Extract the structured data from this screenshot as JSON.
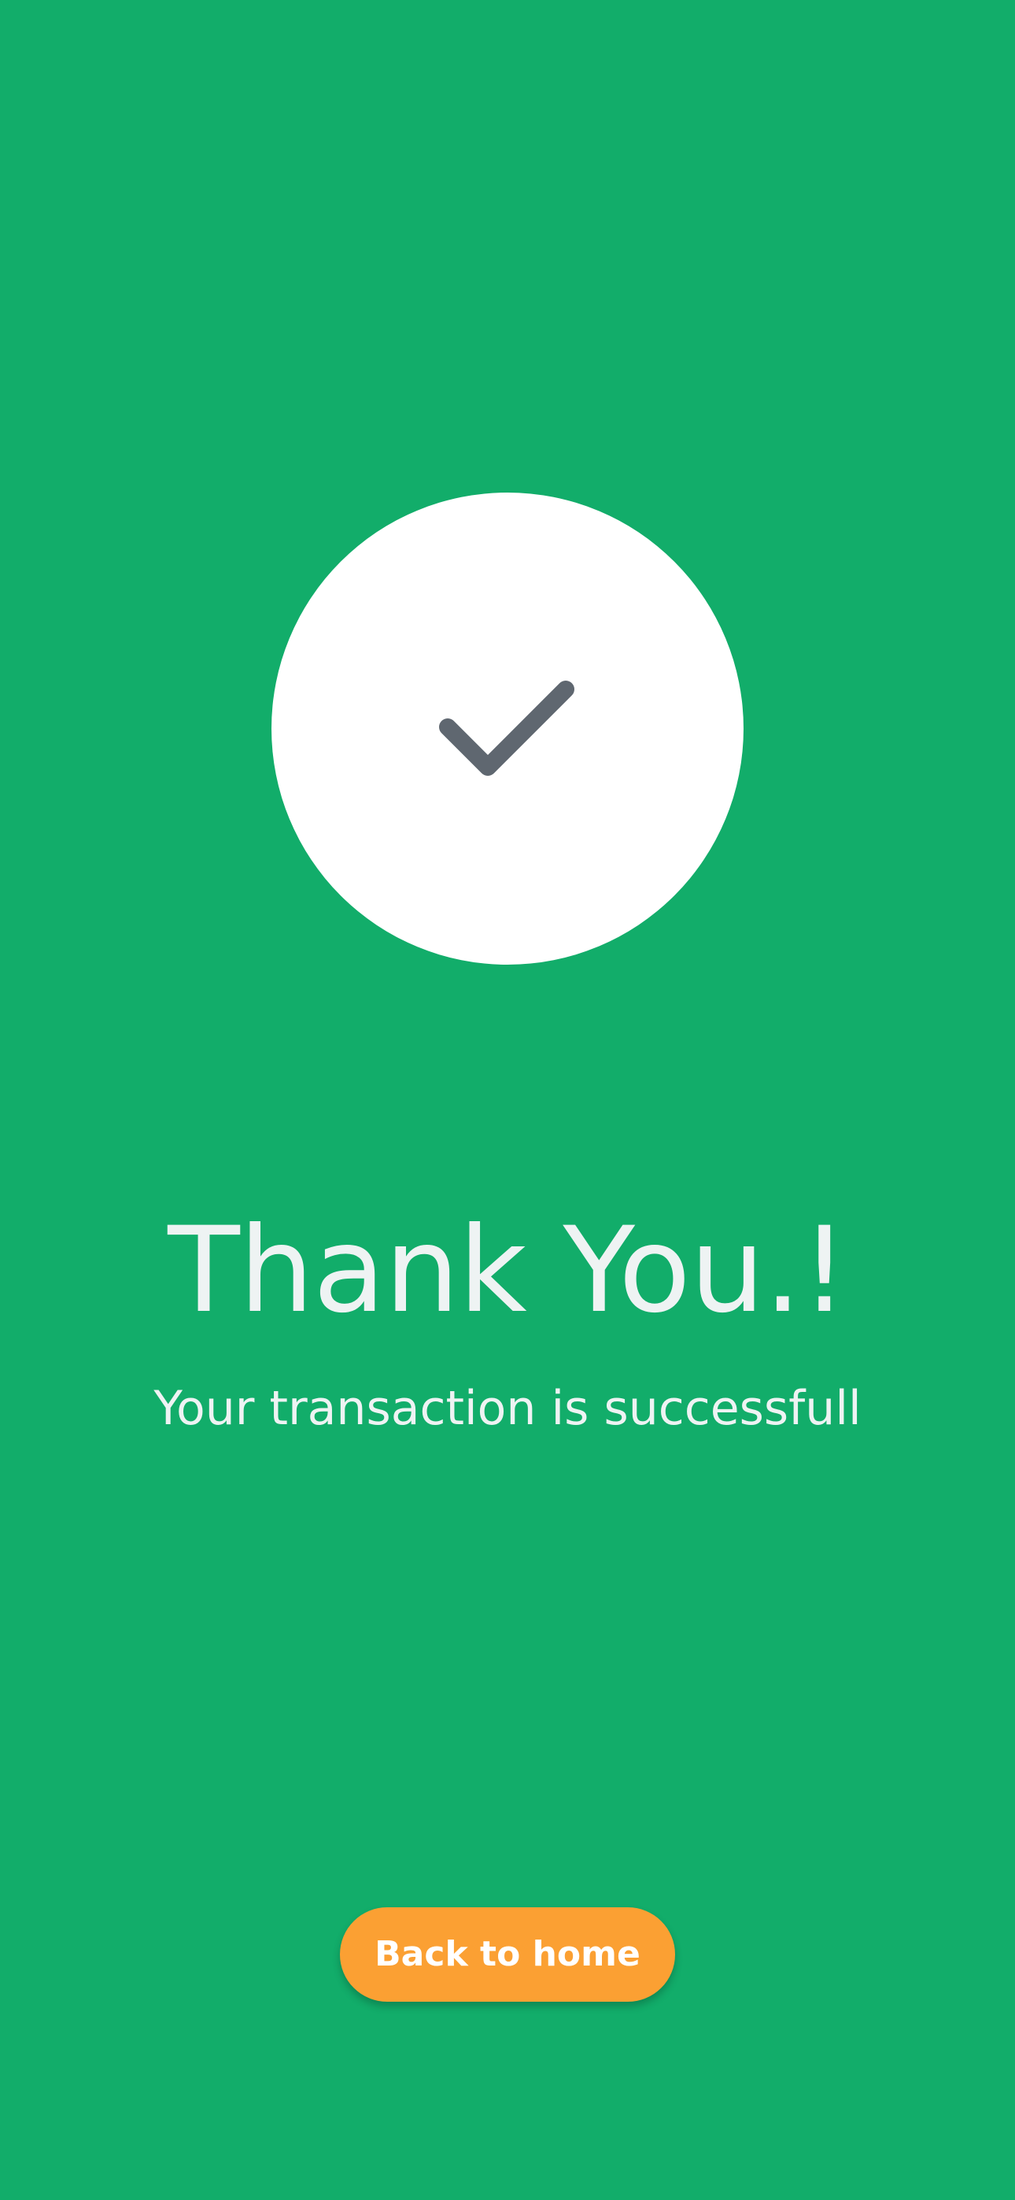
{
  "success": {
    "icon": "check-icon",
    "title": "Thank You.!",
    "message": "Your transaction is successfull"
  },
  "actions": {
    "back_home_label": "Back to home"
  },
  "colors": {
    "background": "#12ad6a",
    "circle": "#ffffff",
    "check": "#5f6770",
    "text": "#eef3f3",
    "button": "#fba033",
    "button_text": "#ffffff"
  }
}
